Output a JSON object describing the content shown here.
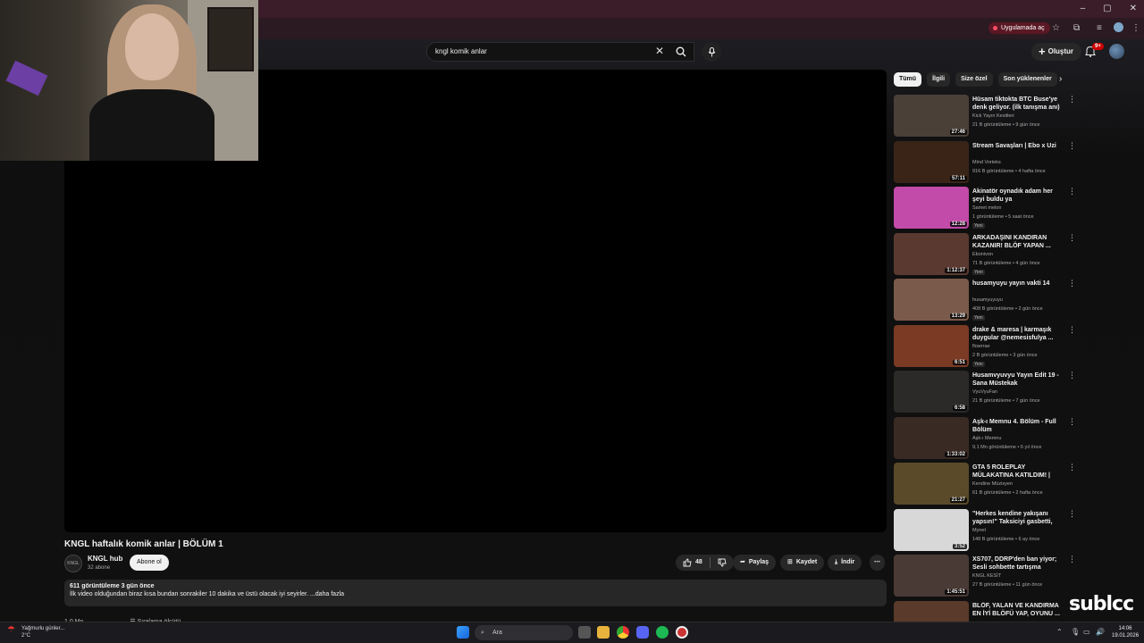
{
  "browser": {
    "open_in_app_label": "Uygulamada aç",
    "window_controls": [
      "–",
      "▢",
      "✕"
    ]
  },
  "youtube": {
    "search": {
      "value": "kngl komik anlar"
    },
    "create_label": "Oluştur",
    "notification_count": "9+"
  },
  "video": {
    "title": "KNGL haftalık komik anlar | BÖLÜM 1",
    "channel": "KNGL hub",
    "channel_avatar_text": "KNGL",
    "subscribers": "32 abone",
    "subscribe_label": "Abone ol",
    "likes": "48",
    "share_label": "Paylaş",
    "save_label": "Kaydet",
    "download_label": "İndir",
    "desc_meta": "611 görüntüleme  3 gün önce",
    "desc_text": "İlk video olduğundan biraz kısa bundan sonrakiler 10 dakika ve üstü olacak iyi seyirler. ...daha fazla",
    "below_left": "1,0 Mn",
    "below_sort": "Sıralama ölçütü"
  },
  "chips": [
    "Tümü",
    "İlgili",
    "Size özel",
    "Son yüklenenler"
  ],
  "recommendations": [
    {
      "title": "Hüsam tiktokta BTC Buse'ye denk geliyor. (ilk tanışma anı) ...",
      "channel": "Kick Yayın Kesitleri",
      "meta": "21 B görüntüleme • 9 gün önce",
      "duration": "27:46",
      "badge": "",
      "color": "#4a4038"
    },
    {
      "title": "Stream Savaşları | Ebo x Uzi",
      "channel": "Mind Vorteks",
      "meta": "916 B görüntüleme • 4 hafta önce",
      "duration": "57:11",
      "badge": "",
      "color": "#3a2418"
    },
    {
      "title": "Akinatör oynadık adam her şeyi buldu ya",
      "channel": "Samet melon",
      "meta": "1 görüntüleme • 5 saat önce",
      "duration": "12:28",
      "badge": "Yeni",
      "color": "#c24aa8"
    },
    {
      "title": "ARKADAŞINI KANDIRAN KAZANIR! BLÖF YAPAN ...",
      "channel": "Ebonivon",
      "meta": "71 B görüntüleme • 4 gün önce",
      "duration": "1:12:37",
      "badge": "Yeni",
      "color": "#5a3a30"
    },
    {
      "title": "husamyuyu yayın vakti 14",
      "channel": "husamyuyuyu",
      "meta": "408 B görüntüleme • 2 gün önce",
      "duration": "13:29",
      "badge": "Yeni",
      "color": "#7a5a4a"
    },
    {
      "title": "drake & maresa | karmaşık duygular @nemesisfulya ...",
      "channel": "flowrrae",
      "meta": "2 B görüntüleme • 3 gün önce",
      "duration": "6:51",
      "badge": "Yeni",
      "color": "#7a3a24"
    },
    {
      "title": "Husamvyuvyu Yayın Edit 19 - Sana Müstekak",
      "channel": "VyuVyuFan",
      "meta": "21 B görüntüleme • 7 gün önce",
      "duration": "6:58",
      "badge": "",
      "color": "#2c2a28"
    },
    {
      "title": "Aşk-ı Memnu 4. Bölüm - Full Bölüm",
      "channel": "Aşk-ı Memnu",
      "meta": "9,1 Mn görüntüleme • 6 yıl önce",
      "duration": "1:33:02",
      "badge": "",
      "color": "#3a2a24"
    },
    {
      "title": "GTA 5 ROLEPLAY MÜLAKATINA KATILDIM! | ADIMIZI ALTIN ...",
      "channel": "Kendine Müzisyen",
      "meta": "61 B görüntüleme • 2 hafta önce",
      "duration": "21:27",
      "badge": "",
      "color": "#5a4a2a"
    },
    {
      "title": "\"Herkes kendine yakışanı yapsın!\" Taksiciyi gasbetti, ara...",
      "channel": "Mynet",
      "meta": "148 B görüntüleme • 6 ay önce",
      "duration": "3:52",
      "badge": "",
      "color": "#d8d8d8"
    },
    {
      "title": "XS707, DDRP'den ban yiyor; Sesli sohbette tartışma çıkıyor.",
      "channel": "KNGL KESİT",
      "meta": "27 B görüntüleme • 11 gün önce",
      "duration": "1:45:51",
      "badge": "",
      "color": "#4a3a36"
    },
    {
      "title": "BLÖF, YALAN VE KANDIRMA EN İYİ BLÖFÜ YAP, OYUNU ...",
      "channel": "",
      "meta": "",
      "duration": "",
      "badge": "",
      "color": "#5a3a2a"
    }
  ],
  "watermark": "sublcc",
  "taskbar": {
    "weather_title": "Yağmurlu günler...",
    "weather_temp": "2°C",
    "search_placeholder": "Ara",
    "time": "14:06",
    "date": "19.01.2026"
  }
}
